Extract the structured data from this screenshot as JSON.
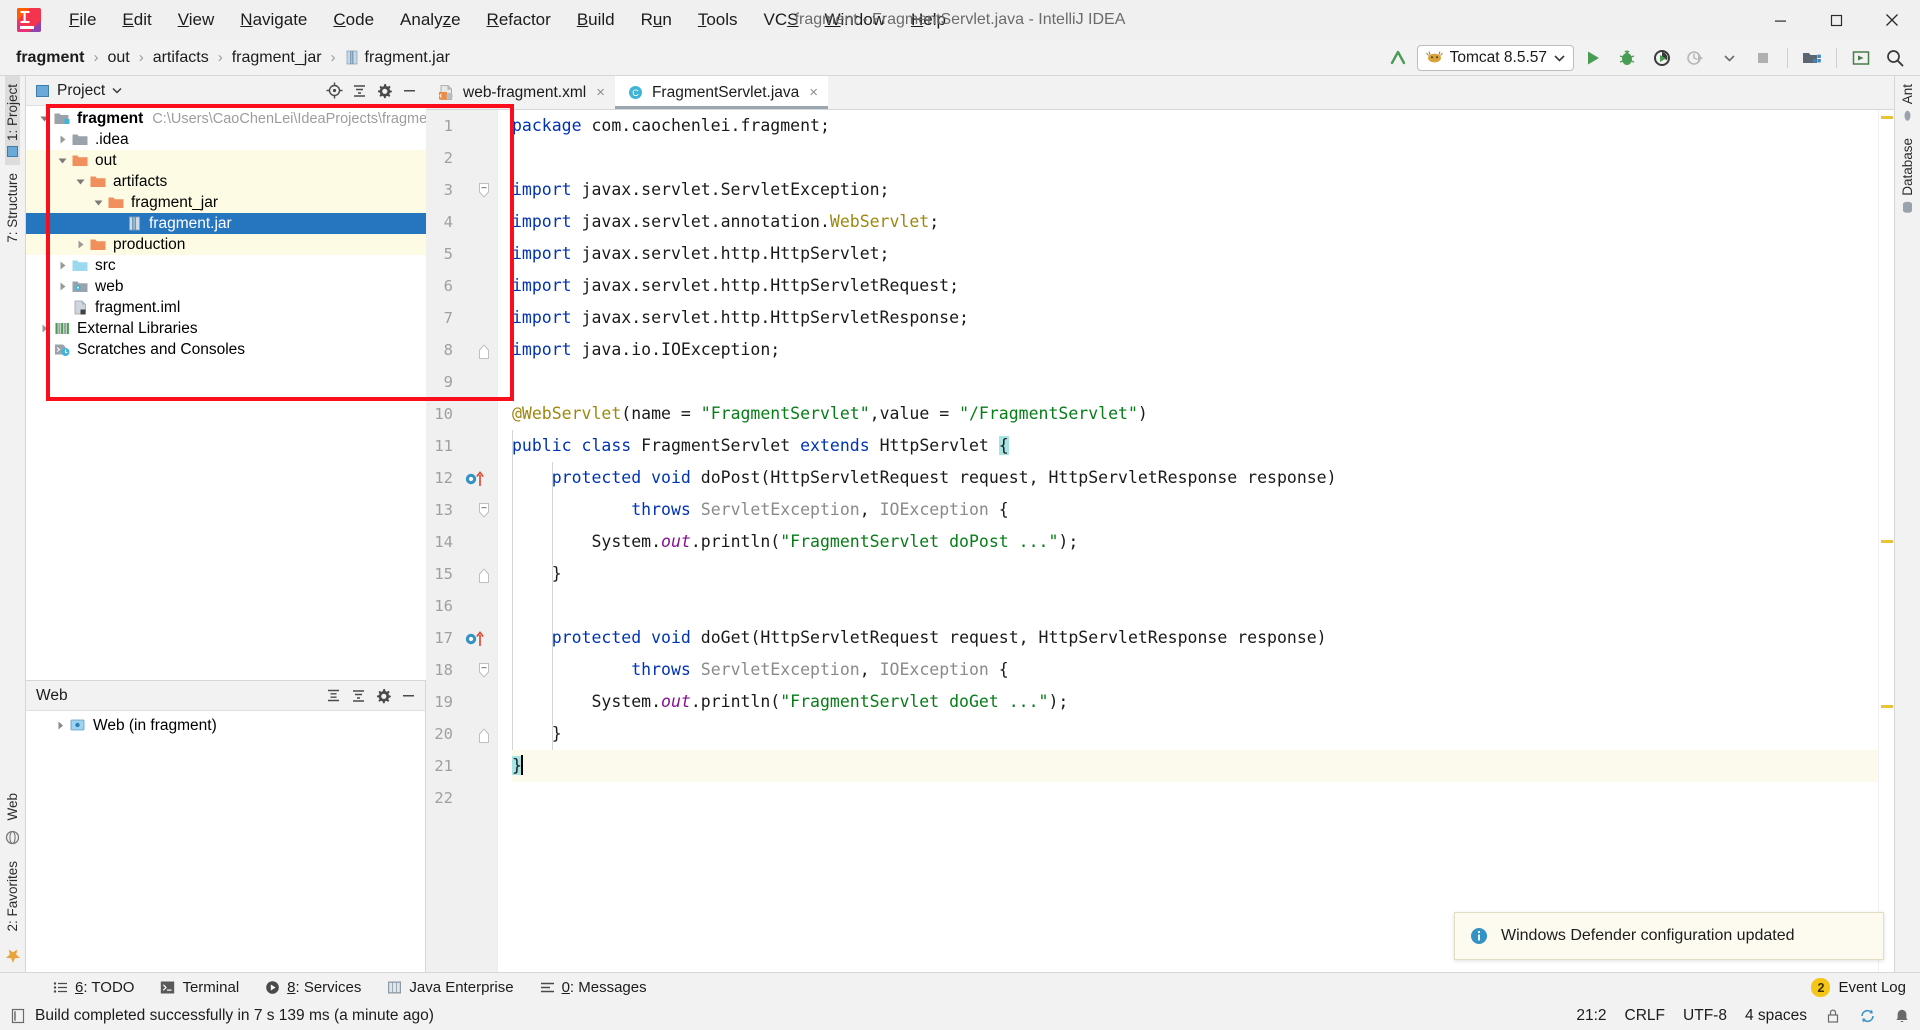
{
  "window": {
    "title": "fragment - FragmentServlet.java - IntelliJ IDEA",
    "minimize_label": "Minimize",
    "maximize_label": "Maximize",
    "close_label": "Close"
  },
  "menubar": {
    "items": [
      {
        "label": "File",
        "mnemonic": "F"
      },
      {
        "label": "Edit",
        "mnemonic": "E"
      },
      {
        "label": "View",
        "mnemonic": "V"
      },
      {
        "label": "Navigate",
        "mnemonic": "N"
      },
      {
        "label": "Code",
        "mnemonic": "C"
      },
      {
        "label": "Analyze",
        "mnemonic": "z"
      },
      {
        "label": "Refactor",
        "mnemonic": "R"
      },
      {
        "label": "Build",
        "mnemonic": "B"
      },
      {
        "label": "Run",
        "mnemonic": "n"
      },
      {
        "label": "Tools",
        "mnemonic": "T"
      },
      {
        "label": "VCS",
        "mnemonic": "S"
      },
      {
        "label": "Window",
        "mnemonic": "W"
      },
      {
        "label": "Help",
        "mnemonic": "H"
      }
    ]
  },
  "breadcrumb": {
    "items": [
      "fragment",
      "out",
      "artifacts",
      "fragment_jar",
      "fragment.jar"
    ],
    "separator": "›"
  },
  "toolbar": {
    "run_config": "Tomcat 8.5.57",
    "run_config_icon": "tomcat-icon",
    "update_icon": "update-running-application-icon",
    "run_label": "Run",
    "debug_label": "Debug",
    "coverage_label": "Run with Coverage",
    "profile_label": "Profile",
    "stop_label": "Stop",
    "project_structure_label": "Project Structure",
    "layout_label": "Layout",
    "search_label": "Search Everywhere"
  },
  "left_strip": {
    "items": [
      "1: Project",
      "7: Structure"
    ],
    "bottom_items": [
      "Web",
      "2: Favorites"
    ],
    "star_icon": "star-icon"
  },
  "right_strip": {
    "items": [
      "Ant",
      "Database"
    ]
  },
  "project_panel": {
    "title": "Project",
    "dropdown_icon": "chevron-down-icon",
    "actions": [
      "locate-icon",
      "collapse-all-icon",
      "gear-icon",
      "hide-icon"
    ],
    "tree": [
      {
        "label": "fragment",
        "path": "C:\\Users\\CaoChenLei\\IdeaProjects\\fragment",
        "depth": 0,
        "arrow": "down",
        "icon": "module-icon",
        "bold": true,
        "state": "normal"
      },
      {
        "label": ".idea",
        "path": "",
        "depth": 1,
        "arrow": "right",
        "icon": "folder-grey-icon",
        "bold": false,
        "state": "normal"
      },
      {
        "label": "out",
        "path": "",
        "depth": 1,
        "arrow": "down",
        "icon": "folder-orange-icon",
        "bold": false,
        "state": "highlight"
      },
      {
        "label": "artifacts",
        "path": "",
        "depth": 2,
        "arrow": "down",
        "icon": "folder-orange-icon",
        "bold": false,
        "state": "highlight"
      },
      {
        "label": "fragment_jar",
        "path": "",
        "depth": 3,
        "arrow": "down",
        "icon": "folder-orange-icon",
        "bold": false,
        "state": "highlight"
      },
      {
        "label": "fragment.jar",
        "path": "",
        "depth": 4,
        "arrow": "none",
        "icon": "jar-icon",
        "bold": false,
        "state": "selected"
      },
      {
        "label": "production",
        "path": "",
        "depth": 2,
        "arrow": "right",
        "icon": "folder-orange-icon",
        "bold": false,
        "state": "highlight"
      },
      {
        "label": "src",
        "path": "",
        "depth": 1,
        "arrow": "right",
        "icon": "folder-source-icon",
        "bold": false,
        "state": "normal"
      },
      {
        "label": "web",
        "path": "",
        "depth": 1,
        "arrow": "right",
        "icon": "folder-web-icon",
        "bold": false,
        "state": "normal"
      },
      {
        "label": "fragment.iml",
        "path": "",
        "depth": 1,
        "arrow": "none",
        "icon": "iml-file-icon",
        "bold": false,
        "state": "normal"
      },
      {
        "label": "External Libraries",
        "path": "",
        "depth": 0,
        "arrow": "right",
        "icon": "libraries-icon",
        "bold": false,
        "state": "normal"
      },
      {
        "label": "Scratches and Consoles",
        "path": "",
        "depth": 0,
        "arrow": "none",
        "icon": "scratches-icon",
        "bold": false,
        "state": "normal"
      }
    ]
  },
  "web_panel": {
    "title": "Web",
    "actions": [
      "expand-all-icon",
      "collapse-all-icon",
      "gear-icon",
      "hide-icon"
    ],
    "tree": [
      {
        "label": "Web (in fragment)",
        "arrow": "right",
        "icon": "web-facet-icon"
      }
    ]
  },
  "editor": {
    "tabs": [
      {
        "label": "web-fragment.xml",
        "icon": "xml-file-icon",
        "active": false,
        "close": "×"
      },
      {
        "label": "FragmentServlet.java",
        "icon": "java-class-icon",
        "active": true,
        "close": "×"
      }
    ],
    "total_lines": 22,
    "current_line": 21,
    "lines": [
      {
        "n": 1,
        "tokens": [
          {
            "t": "package",
            "c": "kw"
          },
          {
            "t": " com.caochenlei.fragment;",
            "c": "plain"
          }
        ]
      },
      {
        "n": 2,
        "tokens": []
      },
      {
        "n": 3,
        "tokens": [
          {
            "t": "import",
            "c": "kw"
          },
          {
            "t": " javax.servlet.ServletException;",
            "c": "plain"
          }
        ],
        "fold": "start"
      },
      {
        "n": 4,
        "tokens": [
          {
            "t": "import",
            "c": "kw"
          },
          {
            "t": " javax.servlet.annotation.",
            "c": "plain"
          },
          {
            "t": "WebServlet",
            "c": "anno"
          },
          {
            "t": ";",
            "c": "plain"
          }
        ]
      },
      {
        "n": 5,
        "tokens": [
          {
            "t": "import",
            "c": "kw"
          },
          {
            "t": " javax.servlet.http.HttpServlet;",
            "c": "plain"
          }
        ]
      },
      {
        "n": 6,
        "tokens": [
          {
            "t": "import",
            "c": "kw"
          },
          {
            "t": " javax.servlet.http.HttpServletRequest;",
            "c": "plain"
          }
        ]
      },
      {
        "n": 7,
        "tokens": [
          {
            "t": "import",
            "c": "kw"
          },
          {
            "t": " javax.servlet.http.HttpServletResponse;",
            "c": "plain"
          }
        ]
      },
      {
        "n": 8,
        "tokens": [
          {
            "t": "import",
            "c": "kw"
          },
          {
            "t": " java.io.IOException;",
            "c": "plain"
          }
        ],
        "fold": "end"
      },
      {
        "n": 9,
        "tokens": []
      },
      {
        "n": 10,
        "tokens": [
          {
            "t": "@WebServlet",
            "c": "anno"
          },
          {
            "t": "(name = ",
            "c": "plain"
          },
          {
            "t": "\"FragmentServlet\"",
            "c": "str"
          },
          {
            "t": ",value = ",
            "c": "plain"
          },
          {
            "t": "\"/FragmentServlet\"",
            "c": "str"
          },
          {
            "t": ")",
            "c": "plain"
          }
        ]
      },
      {
        "n": 11,
        "tokens": [
          {
            "t": "public",
            "c": "kw"
          },
          {
            "t": " ",
            "c": "plain"
          },
          {
            "t": "class",
            "c": "kw"
          },
          {
            "t": " FragmentServlet ",
            "c": "plain"
          },
          {
            "t": "extends",
            "c": "kw"
          },
          {
            "t": " HttpServlet ",
            "c": "plain"
          },
          {
            "t": "{",
            "c": "brace"
          }
        ]
      },
      {
        "n": 12,
        "tokens": [
          {
            "t": "    ",
            "c": "plain"
          },
          {
            "t": "protected",
            "c": "kw"
          },
          {
            "t": " ",
            "c": "plain"
          },
          {
            "t": "void",
            "c": "kw"
          },
          {
            "t": " ",
            "c": "plain"
          },
          {
            "t": "doPost",
            "c": "method"
          },
          {
            "t": "(HttpServletRequest request, HttpServletResponse response)",
            "c": "plain"
          }
        ],
        "gutter": "override-icon"
      },
      {
        "n": 13,
        "tokens": [
          {
            "t": "            ",
            "c": "plain"
          },
          {
            "t": "throws",
            "c": "kw"
          },
          {
            "t": " ",
            "c": "plain"
          },
          {
            "t": "ServletException",
            "c": "grey"
          },
          {
            "t": ", ",
            "c": "plain"
          },
          {
            "t": "IOException",
            "c": "grey"
          },
          {
            "t": " {",
            "c": "plain"
          }
        ],
        "fold": "start"
      },
      {
        "n": 14,
        "tokens": [
          {
            "t": "        System.",
            "c": "plain"
          },
          {
            "t": "out",
            "c": "stat"
          },
          {
            "t": ".println(",
            "c": "plain"
          },
          {
            "t": "\"FragmentServlet doPost ...\"",
            "c": "str"
          },
          {
            "t": ");",
            "c": "plain"
          }
        ]
      },
      {
        "n": 15,
        "tokens": [
          {
            "t": "    }",
            "c": "plain"
          }
        ],
        "fold": "end"
      },
      {
        "n": 16,
        "tokens": []
      },
      {
        "n": 17,
        "tokens": [
          {
            "t": "    ",
            "c": "plain"
          },
          {
            "t": "protected",
            "c": "kw"
          },
          {
            "t": " ",
            "c": "plain"
          },
          {
            "t": "void",
            "c": "kw"
          },
          {
            "t": " ",
            "c": "plain"
          },
          {
            "t": "doGet",
            "c": "method"
          },
          {
            "t": "(HttpServletRequest request, HttpServletResponse response)",
            "c": "plain"
          }
        ],
        "gutter": "override-icon"
      },
      {
        "n": 18,
        "tokens": [
          {
            "t": "            ",
            "c": "plain"
          },
          {
            "t": "throws",
            "c": "kw"
          },
          {
            "t": " ",
            "c": "plain"
          },
          {
            "t": "ServletException",
            "c": "grey"
          },
          {
            "t": ", ",
            "c": "plain"
          },
          {
            "t": "IOException",
            "c": "grey"
          },
          {
            "t": " {",
            "c": "plain"
          }
        ],
        "fold": "start"
      },
      {
        "n": 19,
        "tokens": [
          {
            "t": "        System.",
            "c": "plain"
          },
          {
            "t": "out",
            "c": "stat"
          },
          {
            "t": ".println(",
            "c": "plain"
          },
          {
            "t": "\"FragmentServlet doGet ...\"",
            "c": "str"
          },
          {
            "t": ");",
            "c": "plain"
          }
        ]
      },
      {
        "n": 20,
        "tokens": [
          {
            "t": "    }",
            "c": "plain"
          }
        ],
        "fold": "end"
      },
      {
        "n": 21,
        "tokens": [
          {
            "t": "}",
            "c": "brace"
          }
        ],
        "current": true
      },
      {
        "n": 22,
        "tokens": []
      }
    ]
  },
  "notification": {
    "icon": "info-icon",
    "text": "Windows Defender configuration updated"
  },
  "bottom_tools": [
    {
      "label": "6: TODO",
      "mnemonic": "6",
      "icon": "todo-icon"
    },
    {
      "label": "Terminal",
      "mnemonic": "",
      "icon": "terminal-icon"
    },
    {
      "label": "8: Services",
      "mnemonic": "8",
      "icon": "services-icon"
    },
    {
      "label": "Java Enterprise",
      "mnemonic": "",
      "icon": "java-enterprise-icon"
    },
    {
      "label": "0: Messages",
      "mnemonic": "0",
      "icon": "messages-icon"
    }
  ],
  "event_log": {
    "label": "Event Log",
    "count": "2",
    "icon": "event-log-icon"
  },
  "statusbar": {
    "message": "Build completed successfully in 7 s 139 ms (a minute ago)",
    "message_icon": "build-icon",
    "position": "21:2",
    "line_separator": "CRLF",
    "encoding": "UTF-8",
    "indent": "4 spaces",
    "lock_icon": "lock-icon",
    "sync_icon": "sync-icon",
    "notify_icon": "bell-icon"
  },
  "colors": {
    "accent": "#2675bf",
    "annotation_box": "#fc0d1b",
    "highlight_row": "#fdfbe4",
    "keyword": "#0033b3",
    "string": "#067d17",
    "annotation": "#9e880d",
    "static_field": "#871094",
    "green_run": "#499c54"
  }
}
